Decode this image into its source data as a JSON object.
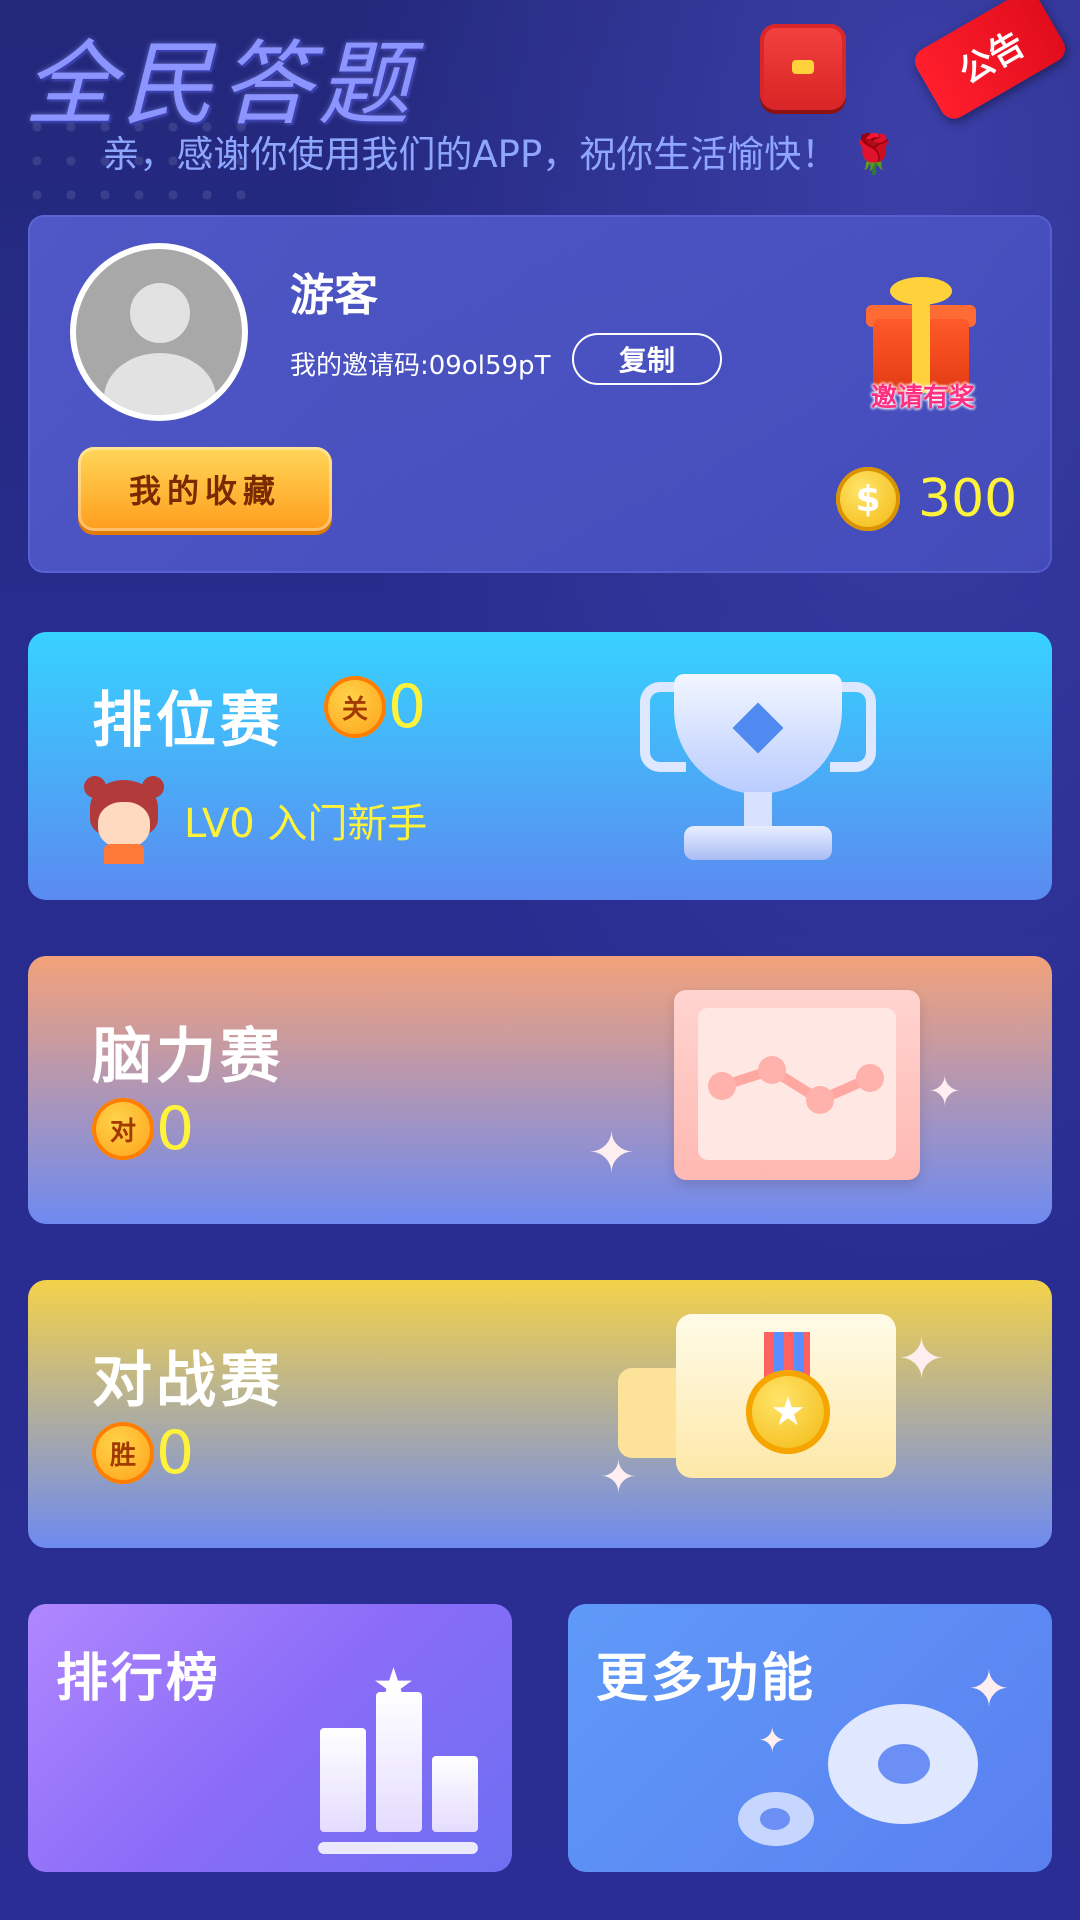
{
  "header": {
    "title": "全民答题",
    "notice_label": "公告",
    "greeting": "亲，感谢你使用我们的APP，祝你生活愉快！",
    "greeting_icon": "rose-icon"
  },
  "profile": {
    "username": "游客",
    "invite_code_label": "我的邀请码:09ol59pT",
    "copy_label": "复制",
    "favorites_label": "我的收藏",
    "invite_reward_label": "邀请有奖",
    "coin_count": "300"
  },
  "cards": {
    "ranked": {
      "title": "排位赛",
      "badge": "关",
      "count": "0",
      "level": "LV0 入门新手"
    },
    "brain": {
      "title": "脑力赛",
      "badge": "对",
      "count": "0"
    },
    "battle": {
      "title": "对战赛",
      "badge": "胜",
      "count": "0"
    }
  },
  "tiles": {
    "leaderboard": "排行榜",
    "more": "更多功能"
  },
  "colors": {
    "background": "#2a2d93",
    "accent_yellow": "#fff23a",
    "ranked_card": "#37d2ff",
    "brain_card": "#f3a27a",
    "battle_card": "#f3d24a"
  }
}
